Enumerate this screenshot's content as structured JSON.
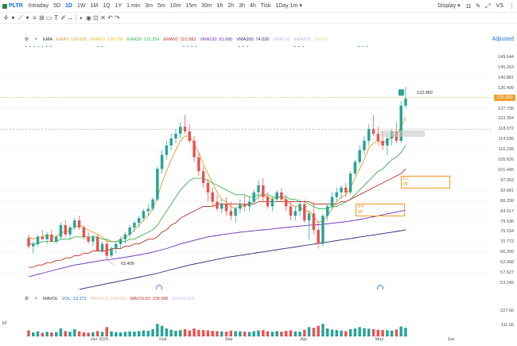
{
  "toolbar": {
    "symbol": "PLTR",
    "timeframes": [
      "Intraday",
      "5D",
      "1D",
      "1W",
      "1M",
      "1Q",
      "1Y",
      "1 min",
      "3m",
      "5m",
      "10m",
      "15m",
      "30m",
      "1h",
      "2h",
      "3h",
      "4h",
      "Tick"
    ],
    "active_timeframe": "1D",
    "range_label": "1Day",
    "interval_label": "1m",
    "display_label": "Display",
    "vs_label": "VS",
    "more_label": "..."
  },
  "legend": {
    "ema": "EMA",
    "ema5": "EMA5: 124.625",
    "ema10": "EMA10: 130.738",
    "ema20": "EMA20: 115.254",
    "ema50": "EMA50: 101.982",
    "ema150": "VMA150: 81.680",
    "ema200": "VMA200: 74.026",
    "ma_extra1": "EMA120",
    "ma_extra2": "EMA250",
    "ma_extra3": "EMA20",
    "adjusted": "Adjusted"
  },
  "price_axis": {
    "labels": [
      "149.644",
      "145.263",
      "140.881",
      "136.499",
      "132.420",
      "127.735",
      "123.354",
      "118.972",
      "114.590",
      "110.208",
      "105.826",
      "101.445",
      "97.063",
      "92.681",
      "88.299",
      "83.917",
      "79.536",
      "75.154",
      "70.772",
      "66.390",
      "62.008",
      "57.627",
      "53.245"
    ],
    "current_price": "132.420"
  },
  "annotations": {
    "low_label": "63.400",
    "high_label": "132.960",
    "box1_line1": "5.7",
    "box1_line2": "99",
    "box2_line1": "8.4",
    "box2_line2": "99"
  },
  "volume": {
    "legend_mavol": "MAVOL",
    "legend_vol": "VOL: 12.272",
    "legend_mavol5": "MAVOL5: 128.455",
    "legend_mavol50": "MAVOL50: 108.686",
    "legend_mavol200": "MAVOL200",
    "axis_labels": [
      "227.66",
      "111.60",
      "M"
    ]
  },
  "dates": [
    "Jan 2025",
    "Feb",
    "Mar",
    "Apr",
    "May",
    "Jun"
  ],
  "colors": {
    "up": "#26a69a",
    "down": "#ef5350",
    "accent": "#1e6fd9",
    "ema5": "#e0a030",
    "ema10": "#e8c020",
    "ema20": "#3cb850",
    "ema50": "#c0392b",
    "ema150": "#6a35b8",
    "ema200": "#3b2a80"
  },
  "chart_data": {
    "type": "candlestick",
    "ylim": [
      53.245,
      149.644
    ],
    "candles_ohlc": [
      [
        72.5,
        74,
        68,
        69
      ],
      [
        69,
        71,
        66,
        70
      ],
      [
        70,
        74,
        69,
        73
      ],
      [
        73,
        76,
        72,
        72
      ],
      [
        72,
        75,
        70,
        74
      ],
      [
        74,
        76,
        71,
        71
      ],
      [
        71,
        74,
        70,
        73
      ],
      [
        73,
        79,
        72,
        78
      ],
      [
        78,
        80,
        73,
        74
      ],
      [
        74,
        78,
        72,
        77
      ],
      [
        77,
        81,
        76,
        80
      ],
      [
        80,
        82,
        76,
        77
      ],
      [
        77,
        78,
        72,
        73
      ],
      [
        73,
        75,
        70,
        71
      ],
      [
        71,
        74,
        69,
        73
      ],
      [
        73,
        74,
        67,
        67
      ],
      [
        67,
        71,
        66,
        70
      ],
      [
        70,
        72,
        63.4,
        65
      ],
      [
        65,
        69,
        64,
        68
      ],
      [
        68,
        71,
        66,
        70
      ],
      [
        70,
        73,
        68,
        72
      ],
      [
        72,
        75,
        70,
        74
      ],
      [
        74,
        78,
        73,
        77
      ],
      [
        77,
        80,
        75,
        79
      ],
      [
        79,
        82,
        77,
        81
      ],
      [
        81,
        85,
        80,
        84
      ],
      [
        84,
        87,
        82,
        85
      ],
      [
        85,
        90,
        84,
        89
      ],
      [
        89,
        103,
        88,
        102
      ],
      [
        102,
        110,
        100,
        108
      ],
      [
        108,
        114,
        106,
        112
      ],
      [
        112,
        117,
        110,
        115
      ],
      [
        115,
        119,
        113,
        117
      ],
      [
        117,
        122,
        115,
        120
      ],
      [
        120,
        125,
        117,
        118
      ],
      [
        118,
        121,
        113,
        114
      ],
      [
        114,
        116,
        105,
        107
      ],
      [
        107,
        109,
        99,
        101
      ],
      [
        101,
        103,
        94,
        96
      ],
      [
        96,
        98,
        88,
        92
      ],
      [
        92,
        94,
        86,
        88
      ],
      [
        88,
        91,
        84,
        85
      ],
      [
        85,
        89,
        83,
        87
      ],
      [
        87,
        90,
        82,
        84
      ],
      [
        84,
        88,
        80,
        82
      ],
      [
        82,
        86,
        79,
        85
      ],
      [
        85,
        89,
        83,
        87
      ],
      [
        87,
        91,
        84,
        86
      ],
      [
        86,
        90,
        84,
        88
      ],
      [
        88,
        93,
        87,
        92
      ],
      [
        92,
        97,
        89,
        95
      ],
      [
        95,
        98,
        88,
        90
      ],
      [
        90,
        92,
        85,
        86
      ],
      [
        86,
        90,
        84,
        89
      ],
      [
        89,
        93,
        88,
        92
      ],
      [
        92,
        94,
        88,
        89
      ],
      [
        89,
        91,
        84,
        86
      ],
      [
        86,
        88,
        80,
        82
      ],
      [
        82,
        86,
        80,
        84
      ],
      [
        84,
        89,
        82,
        87
      ],
      [
        87,
        89,
        79,
        80
      ],
      [
        80,
        84,
        72,
        83
      ],
      [
        83,
        88,
        74,
        76
      ],
      [
        76,
        80,
        68,
        70
      ],
      [
        70,
        83,
        69,
        82
      ],
      [
        82,
        87,
        80,
        86
      ],
      [
        86,
        92,
        85,
        90
      ],
      [
        90,
        94,
        88,
        92
      ],
      [
        92,
        95,
        89,
        94
      ],
      [
        94,
        96,
        90,
        92
      ],
      [
        92,
        101,
        91,
        100
      ],
      [
        100,
        106,
        99,
        105
      ],
      [
        105,
        112,
        104,
        110
      ],
      [
        110,
        116,
        108,
        114
      ],
      [
        114,
        121,
        112,
        119
      ],
      [
        119,
        125,
        116,
        117
      ],
      [
        117,
        120,
        112,
        114
      ],
      [
        114,
        118,
        110,
        112
      ],
      [
        112,
        116,
        108,
        115
      ],
      [
        115,
        119,
        112,
        118
      ],
      [
        118,
        122,
        113,
        114
      ],
      [
        114,
        131,
        113,
        129
      ],
      [
        129,
        137,
        128,
        132
      ]
    ],
    "volumes": [
      45,
      30,
      38,
      28,
      35,
      30,
      33,
      60,
      40,
      35,
      55,
      38,
      30,
      28,
      32,
      40,
      35,
      70,
      38,
      32,
      30,
      34,
      38,
      36,
      40,
      45,
      42,
      55,
      95,
      80,
      60,
      50,
      42,
      48,
      55,
      45,
      60,
      50,
      48,
      45,
      42,
      40,
      38,
      36,
      44,
      40,
      38,
      36,
      34,
      40,
      45,
      48,
      38,
      35,
      40,
      36,
      42,
      46,
      38,
      36,
      50,
      70,
      65,
      80,
      95,
      60,
      52,
      48,
      44,
      40,
      55,
      60,
      70,
      62,
      58,
      55,
      50,
      48,
      46,
      44,
      52,
      75,
      65
    ],
    "ema_series": {
      "ema5": [
        73,
        72,
        73,
        73,
        74,
        73,
        73,
        75,
        75,
        76,
        77,
        78,
        77,
        76,
        75,
        74,
        73,
        71,
        71,
        71,
        72,
        73,
        74,
        76,
        78,
        80,
        82,
        85,
        90,
        96,
        101,
        106,
        110,
        114,
        116,
        116,
        113,
        109,
        104,
        100,
        96,
        92,
        89,
        88,
        86,
        85,
        86,
        86,
        87,
        88,
        90,
        91,
        90,
        89,
        90,
        90,
        89,
        87,
        86,
        86,
        84,
        84,
        82,
        79,
        80,
        82,
        85,
        88,
        90,
        91,
        94,
        98,
        102,
        106,
        111,
        113,
        114,
        113,
        114,
        116,
        116,
        120,
        124
      ],
      "ema20": [
        70,
        70,
        70,
        71,
        71,
        71,
        71,
        72,
        72,
        72,
        73,
        73,
        73,
        73,
        73,
        73,
        72,
        72,
        71,
        71,
        71,
        71,
        72,
        72,
        73,
        74,
        75,
        76,
        78,
        81,
        84,
        87,
        90,
        93,
        95,
        97,
        98,
        98,
        98,
        97,
        96,
        95,
        94,
        93,
        92,
        91,
        91,
        91,
        90,
        90,
        91,
        91,
        91,
        90,
        90,
        90,
        90,
        89,
        89,
        88,
        88,
        87,
        86,
        85,
        85,
        85,
        86,
        86,
        87,
        88,
        89,
        91,
        93,
        95,
        97,
        99,
        101,
        102,
        104,
        106,
        107,
        109,
        112
      ],
      "ema50": [
        60,
        60,
        61,
        61,
        62,
        62,
        63,
        63,
        64,
        64,
        65,
        65,
        66,
        66,
        67,
        67,
        67,
        67,
        68,
        68,
        68,
        69,
        69,
        70,
        70,
        71,
        72,
        72,
        73,
        75,
        76,
        78,
        79,
        81,
        82,
        83,
        84,
        85,
        86,
        86,
        86,
        87,
        87,
        87,
        87,
        87,
        87,
        87,
        87,
        87,
        88,
        88,
        88,
        88,
        88,
        88,
        88,
        88,
        88,
        88,
        88,
        88,
        87,
        87,
        87,
        87,
        87,
        87,
        88,
        88,
        89,
        90,
        91,
        92,
        93,
        94,
        95,
        96,
        97,
        98,
        99,
        100,
        102
      ],
      "ema150": [
        56,
        56.5,
        57,
        57.5,
        58,
        58.5,
        59,
        59.5,
        60,
        60.5,
        61,
        61.3,
        61.6,
        62,
        62.3,
        62.6,
        63,
        63.2,
        63.4,
        63.7,
        64,
        64.3,
        64.6,
        65,
        65.3,
        65.7,
        66,
        66.5,
        67,
        67.5,
        68,
        68.7,
        69.3,
        70,
        70.5,
        71,
        71.5,
        72,
        72.5,
        73,
        73.3,
        73.6,
        74,
        74.2,
        74.5,
        74.7,
        75,
        75.2,
        75.4,
        75.6,
        75.8,
        76,
        76.2,
        76.4,
        76.6,
        76.8,
        77,
        77.2,
        77.4,
        77.6,
        77.8,
        78,
        78.1,
        78.2,
        78.4,
        78.6,
        78.8,
        79,
        79.2,
        79.5,
        79.8,
        80.1,
        80.4,
        80.8,
        81.2,
        81.6,
        82,
        82.4,
        82.8,
        83.2,
        83.6,
        84,
        84.4
      ],
      "ema200": [
        45,
        45.5,
        46,
        46.5,
        47,
        47.5,
        48,
        48.5,
        49,
        49.5,
        50,
        50.5,
        51,
        51.4,
        51.8,
        52.2,
        52.6,
        53,
        53.4,
        53.8,
        54.2,
        54.6,
        55,
        55.4,
        55.8,
        56.2,
        56.6,
        57,
        57.5,
        58,
        58.5,
        59,
        59.5,
        60,
        60.5,
        61,
        61.4,
        61.8,
        62.2,
        62.6,
        63,
        63.4,
        63.8,
        64.2,
        64.5,
        64.8,
        65.1,
        65.4,
        65.7,
        66,
        66.3,
        66.6,
        66.9,
        67.2,
        67.5,
        67.8,
        68.1,
        68.4,
        68.7,
        69,
        69.3,
        69.6,
        69.9,
        70.2,
        70.5,
        70.8,
        71.1,
        71.4,
        71.7,
        72,
        72.3,
        72.6,
        72.9,
        73.2,
        73.5,
        73.8,
        74.1,
        74.4,
        74.7,
        75,
        75.3,
        75.6,
        76
      ]
    }
  }
}
